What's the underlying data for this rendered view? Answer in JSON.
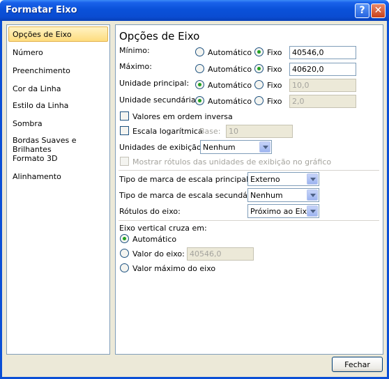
{
  "window": {
    "title": "Formatar Eixo"
  },
  "sidebar": {
    "items": [
      {
        "label": "Opções de Eixo",
        "selected": true
      },
      {
        "label": "Número"
      },
      {
        "label": "Preenchimento"
      },
      {
        "label": "Cor da Linha"
      },
      {
        "label": "Estilo da Linha"
      },
      {
        "label": "Sombra"
      },
      {
        "label": "Bordas Suaves e Brilhantes"
      },
      {
        "label": "Formato 3D"
      },
      {
        "label": "Alinhamento"
      }
    ]
  },
  "axis": {
    "heading": "Opções de Eixo",
    "auto_label": "Automático",
    "fixed_label": "Fixo",
    "rows": [
      {
        "label": "Mínimo:",
        "mode": "fixed",
        "value": "40546,0",
        "enabled": true
      },
      {
        "label": "Máximo:",
        "mode": "fixed",
        "value": "40620,0",
        "enabled": true
      },
      {
        "label": "Unidade principal:",
        "mode": "auto",
        "value": "10,0",
        "enabled": false
      },
      {
        "label": "Unidade secundária:",
        "mode": "auto",
        "value": "2,0",
        "enabled": false
      }
    ],
    "reverse_order_label": "Valores em ordem inversa",
    "log_scale_label": "Escala logarítmica",
    "base_label": "Base:",
    "base_value": "10",
    "display_units_label": "Unidades de exibição:",
    "display_units_value": "Nenhum",
    "show_units_label": "Mostrar rótulos das unidades de exibição no gráfico",
    "major_tick_label": "Tipo de marca de escala principal:",
    "major_tick_value": "Externo",
    "minor_tick_label": "Tipo de marca de escala secundária:",
    "minor_tick_value": "Nenhum",
    "axis_labels_label": "Rótulos do eixo:",
    "axis_labels_value": "Próximo ao Eixo",
    "crosses_label": "Eixo vertical cruza em:",
    "crosses_auto": "Automático",
    "crosses_value_label": "Valor do eixo:",
    "crosses_value": "40546,0",
    "crosses_max": "Valor máximo do eixo"
  },
  "footer": {
    "close_label": "Fechar"
  }
}
